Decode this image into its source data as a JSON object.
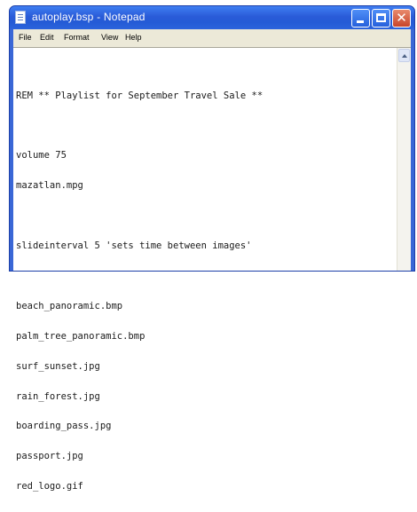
{
  "window": {
    "title": "autoplay.bsp - Notepad"
  },
  "titlebar": {
    "buttons": [
      {
        "name": "minimize",
        "icon": "minimize-icon"
      },
      {
        "name": "maximize",
        "icon": "maximize-icon"
      },
      {
        "name": "close",
        "icon": "close-icon",
        "glyph": "✕"
      }
    ]
  },
  "menubar": {
    "items": [
      "File",
      "Edit",
      "Format",
      "View",
      "Help"
    ]
  },
  "editor": {
    "lines": [
      "REM ** Playlist for September Travel Sale **",
      "",
      "volume 75",
      "mazatlan.mpg",
      "",
      "slideinterval 5 'sets time between images'",
      "",
      "beach_panoramic.bmp",
      "palm_tree_panoramic.bmp",
      "surf_sunset.jpg",
      "rain_forest.jpg",
      "boarding_pass.jpg",
      "passport.jpg",
      "red_logo.gif"
    ]
  },
  "colors": {
    "titlebar": "#245bd6",
    "close_button": "#c8452a",
    "menubar": "#ece9d8"
  }
}
